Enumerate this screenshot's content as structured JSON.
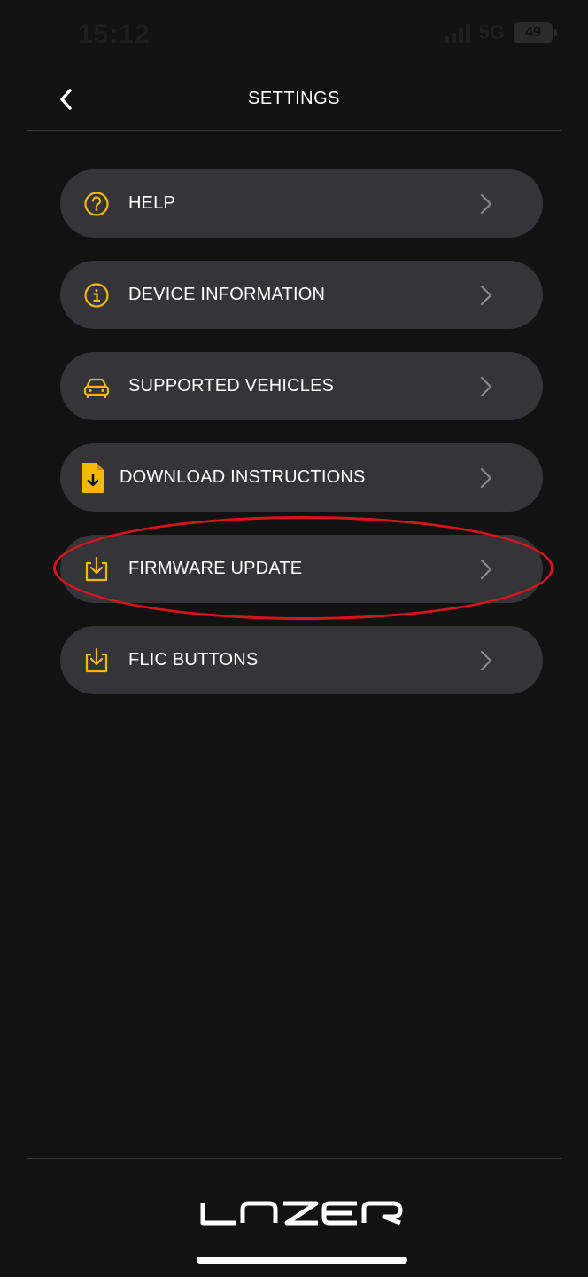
{
  "status_bar": {
    "time": "15:12",
    "network": "5G",
    "battery": "49"
  },
  "header": {
    "title": "SETTINGS"
  },
  "menu": {
    "items": [
      {
        "label": "HELP",
        "icon": "question-circle-icon"
      },
      {
        "label": "DEVICE INFORMATION",
        "icon": "info-circle-icon"
      },
      {
        "label": "SUPPORTED VEHICLES",
        "icon": "car-icon"
      },
      {
        "label": "DOWNLOAD INSTRUCTIONS",
        "icon": "document-download-icon"
      },
      {
        "label": "FIRMWARE UPDATE",
        "icon": "download-tray-icon",
        "highlighted": true
      },
      {
        "label": "FLIC BUTTONS",
        "icon": "download-tray-icon"
      }
    ]
  },
  "footer": {
    "logo": "LAZER"
  },
  "colors": {
    "background": "#131212",
    "card": "#353438",
    "accent": "#f5b800",
    "highlight": "#d8141c",
    "chevron": "#8a8a8e"
  }
}
